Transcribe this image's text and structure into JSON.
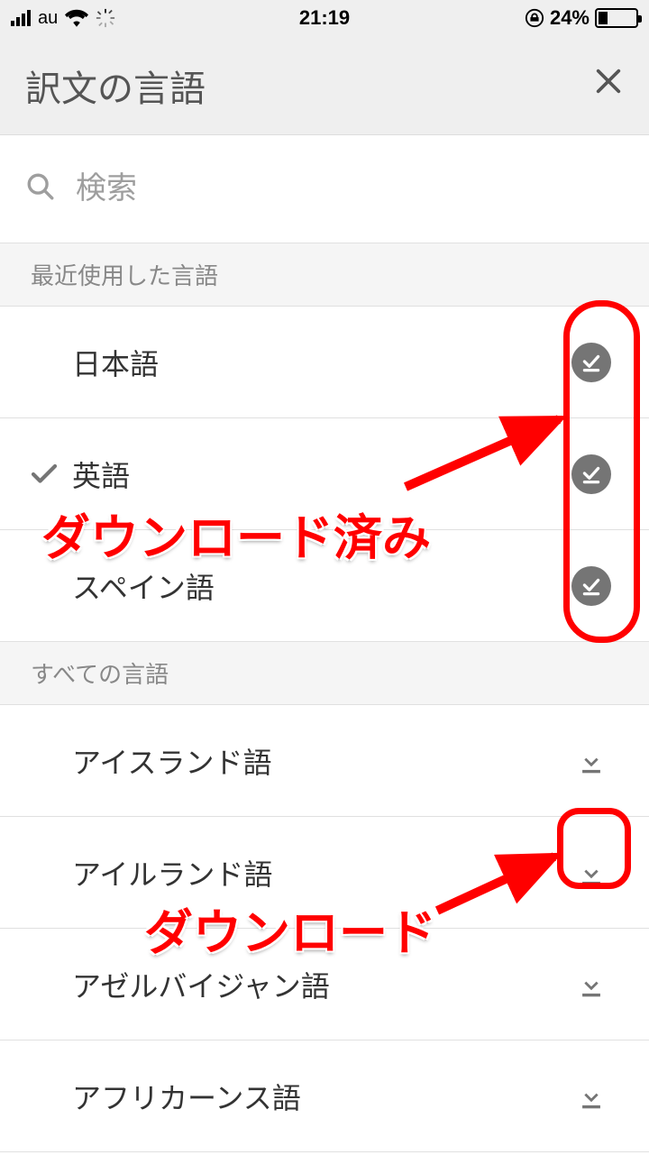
{
  "status": {
    "carrier": "au",
    "time": "21:19",
    "battery_pct": "24%"
  },
  "header": {
    "title": "訳文の言語"
  },
  "search": {
    "placeholder": "検索"
  },
  "sections": {
    "recent": {
      "label": "最近使用した言語"
    },
    "all": {
      "label": "すべての言語"
    }
  },
  "recent_languages": [
    {
      "name": "日本語",
      "selected": false,
      "downloaded": true
    },
    {
      "name": "英語",
      "selected": true,
      "downloaded": true
    },
    {
      "name": "スペイン語",
      "selected": false,
      "downloaded": true
    }
  ],
  "all_languages": [
    {
      "name": "アイスランド語",
      "downloaded": false
    },
    {
      "name": "アイルランド語",
      "downloaded": false
    },
    {
      "name": "アゼルバイジャン語",
      "downloaded": false
    },
    {
      "name": "アフリカーンス語",
      "downloaded": false
    }
  ],
  "annotations": {
    "downloaded_label": "ダウンロード済み",
    "download_label": "ダウンロード"
  }
}
